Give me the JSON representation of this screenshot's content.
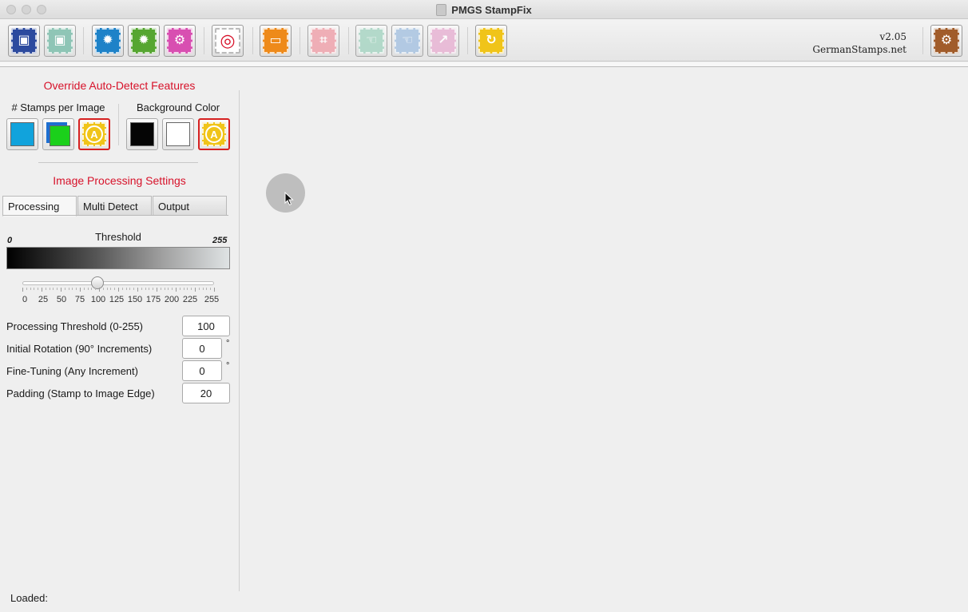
{
  "window": {
    "title": "PMGS StampFix"
  },
  "toolbar": {
    "buttons": [
      {
        "name": "save-button",
        "icon": "save-icon",
        "color": "#2c4a9e",
        "glyph": "▣",
        "enabled": true
      },
      {
        "name": "save-as-button",
        "icon": "save-as-icon",
        "color": "#7fbfad",
        "glyph": "▣",
        "enabled": false
      },
      {
        "name": "auto-detect-blue-button",
        "icon": "auto-detect-icon",
        "color": "#1e82c8",
        "glyph": "✹",
        "enabled": true
      },
      {
        "name": "auto-detect-green-button",
        "icon": "auto-detect-icon",
        "color": "#56a631",
        "glyph": "✹",
        "enabled": true
      },
      {
        "name": "settings-pink-button",
        "icon": "gear-icon",
        "color": "#d84fb1",
        "glyph": "⚙",
        "enabled": true
      },
      {
        "name": "target-button",
        "icon": "target-icon",
        "color": "#ffffff",
        "glyph": "◎",
        "enabled": true
      },
      {
        "name": "display-button",
        "icon": "monitor-icon",
        "color": "#ee8a1a",
        "glyph": "▭",
        "enabled": true
      },
      {
        "name": "crop-button",
        "icon": "crop-icon",
        "color": "#f0a4ad",
        "glyph": "⌗",
        "enabled": false
      },
      {
        "name": "hand-minus-button",
        "icon": "hand-minus-icon",
        "color": "#a9d6c4",
        "glyph": "☜",
        "enabled": false
      },
      {
        "name": "hand-plus-button",
        "icon": "hand-plus-icon",
        "color": "#a9c4e2",
        "glyph": "☜",
        "enabled": false
      },
      {
        "name": "export-button",
        "icon": "export-icon",
        "color": "#e8b4d4",
        "glyph": "↗",
        "enabled": false
      },
      {
        "name": "refresh-button",
        "icon": "refresh-icon",
        "color": "#f0c419",
        "glyph": "↻",
        "enabled": true
      },
      {
        "name": "preferences-button",
        "icon": "gear-icon",
        "color": "#a15c2a",
        "glyph": "⚙",
        "enabled": true
      }
    ],
    "version": "v2.05",
    "website": "GermanStamps.net"
  },
  "override": {
    "heading": "Override Auto-Detect Features",
    "stamps_label": "# Stamps per Image",
    "background_label": "Background Color",
    "stamps_options": [
      {
        "name": "single-stamp-option",
        "swatch": "#11a3dc",
        "selected": false
      },
      {
        "name": "multi-stamp-option",
        "swatch": "#1bd01b",
        "selected": false
      },
      {
        "name": "auto-stamps-option",
        "swatch": "#f0c419",
        "glyph": "A",
        "selected": true
      }
    ],
    "background_options": [
      {
        "name": "black-background-option",
        "swatch": "#050505",
        "selected": false
      },
      {
        "name": "white-background-option",
        "swatch": "#ffffff",
        "selected": false
      },
      {
        "name": "auto-background-option",
        "swatch": "#f0c419",
        "glyph": "A",
        "selected": true
      }
    ]
  },
  "processing": {
    "heading": "Image Processing Settings",
    "tabs": [
      "Processing",
      "Multi Detect",
      "Output"
    ],
    "active_tab": "Processing",
    "threshold_label": "Threshold",
    "threshold_min_label": "0",
    "threshold_max_label": "255",
    "slider_value": 100,
    "slider_max": 255,
    "tick_labels": [
      "0",
      "25",
      "50",
      "75",
      "100",
      "125",
      "150",
      "175",
      "200",
      "225",
      "255"
    ],
    "fields": [
      {
        "label": "Processing Threshold (0-255)",
        "value": "100",
        "unit": ""
      },
      {
        "label": "Initial Rotation (90° Increments)",
        "value": "0",
        "unit": "°"
      },
      {
        "label": "Fine-Tuning (Any Increment)",
        "value": "0",
        "unit": "°"
      },
      {
        "label": "Padding (Stamp to Image Edge)",
        "value": "20",
        "unit": ""
      }
    ]
  },
  "status": {
    "text": "Loaded:"
  }
}
